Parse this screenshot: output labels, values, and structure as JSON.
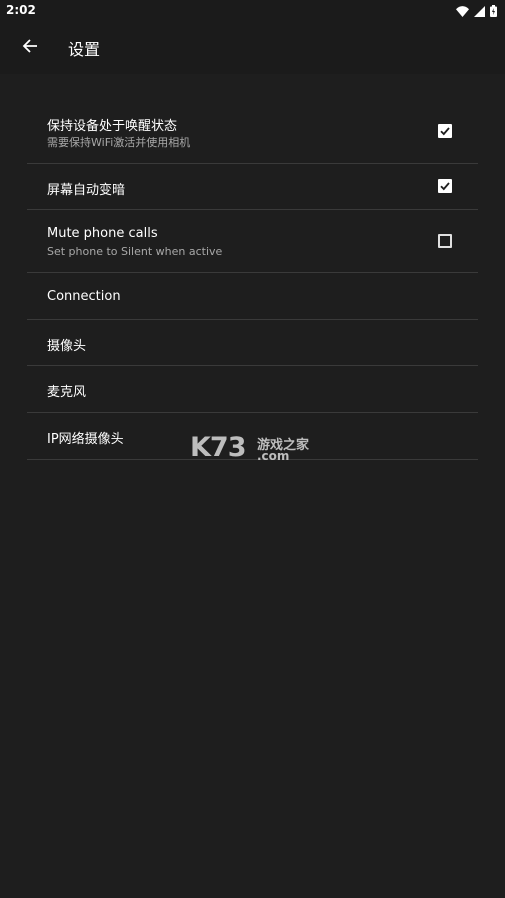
{
  "status_bar": {
    "time": "2:02",
    "icons": [
      "wifi-icon",
      "signal-icon",
      "battery-icon"
    ]
  },
  "app_bar": {
    "title": "设置",
    "back_icon": "arrow-left-icon"
  },
  "settings": {
    "items": [
      {
        "title": "保持设备处于唤醒状态",
        "subtitle": "需要保持WiFi激活并使用相机",
        "checkbox": "checked"
      },
      {
        "title": "屏幕自动变暗",
        "checkbox": "checked"
      },
      {
        "title": "Mute phone calls",
        "subtitle": "Set phone to Silent when active",
        "checkbox": "unchecked"
      },
      {
        "title": "Connection"
      },
      {
        "title": "摄像头"
      },
      {
        "title": "麦克风"
      },
      {
        "title": "IP网络摄像头"
      }
    ]
  },
  "watermark": {
    "brand": "K73",
    "tagline": "游戏之家",
    "domain": ".com"
  },
  "colors": {
    "background": "#1e1e1e",
    "app_bar": "#1b1b1b",
    "divider": "#3a3a3a",
    "text_primary": "#ffffff",
    "text_secondary": "#a8a8a8"
  }
}
